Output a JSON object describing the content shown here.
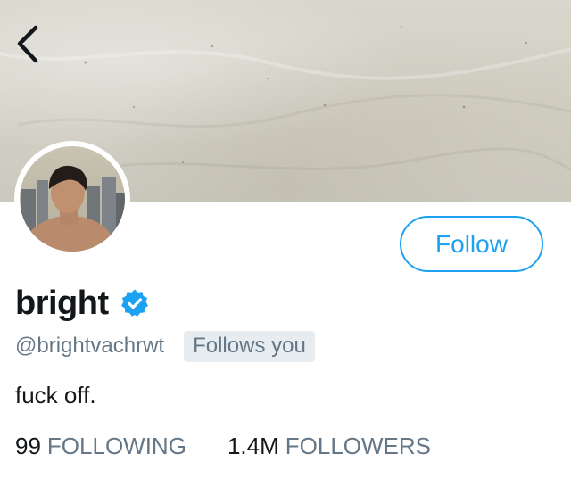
{
  "header": {
    "back_icon": "chevron-left-icon"
  },
  "profile": {
    "display_name": "bright",
    "verified_icon": "verified-badge-icon",
    "handle": "@brightvachrwt",
    "follows_you_label": "Follows you",
    "bio": "fuck off.",
    "follow_button_label": "Follow"
  },
  "stats": {
    "following_count": "99",
    "following_label": "FOLLOWING",
    "followers_count": "1.4M",
    "followers_label": "FOLLOWERS"
  },
  "colors": {
    "accent": "#1da1f2",
    "text_primary": "#14171a",
    "text_secondary": "#657786",
    "badge_bg": "#e6ecf0"
  }
}
